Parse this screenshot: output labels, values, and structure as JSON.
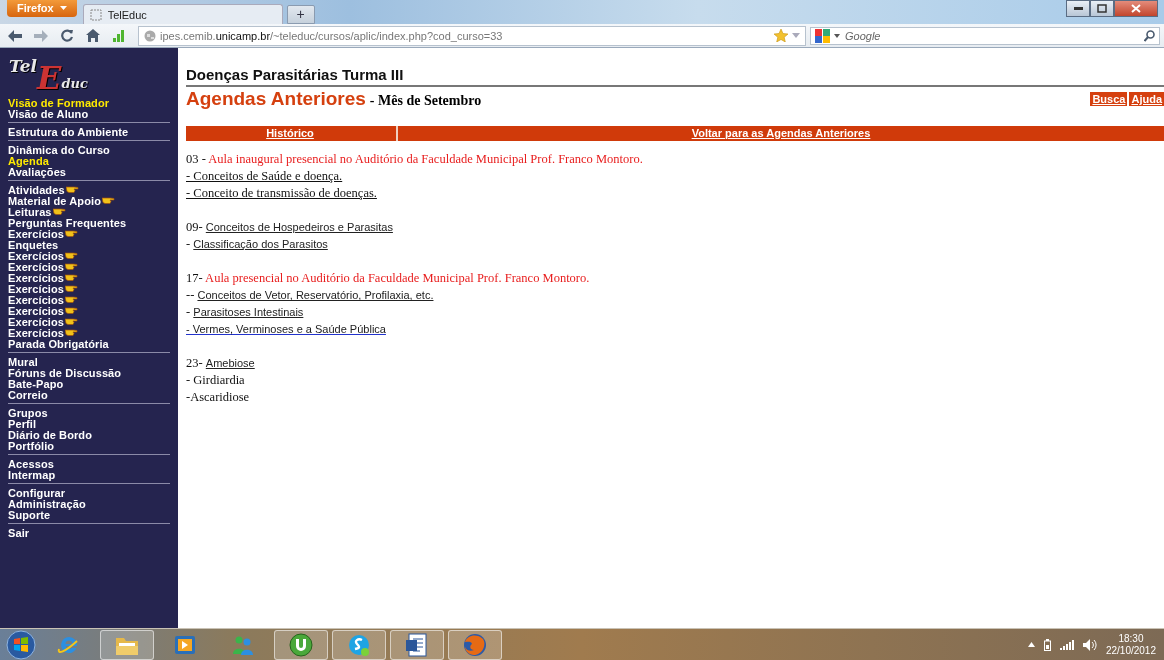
{
  "browser": {
    "menu_button": "Firefox",
    "tabs": [
      {
        "title": "TelEduc",
        "selected": true
      }
    ],
    "new_tab_button": "+",
    "url": "ipes.cemib.**unicamp.br**/~teleduc/cursos/aplic/index.php?cod_curso=33",
    "search_placeholder": "Google"
  },
  "sidebar": {
    "logo": [
      "Tel",
      "E",
      "duc"
    ],
    "groups": [
      {
        "items": [
          {
            "label": "Visão de Formador",
            "selected": true,
            "new": false
          },
          {
            "label": "Visão de Aluno",
            "selected": false,
            "new": false
          }
        ]
      },
      {
        "items": [
          {
            "label": "Estrutura do Ambiente",
            "selected": false,
            "new": false
          }
        ]
      },
      {
        "items": [
          {
            "label": "Dinâmica do Curso",
            "selected": false,
            "new": false
          },
          {
            "label": "Agenda",
            "selected": true,
            "new": false
          },
          {
            "label": "Avaliações",
            "selected": false,
            "new": false
          }
        ]
      },
      {
        "items": [
          {
            "label": "Atividades",
            "selected": false,
            "new": true
          },
          {
            "label": "Material de Apoio",
            "selected": false,
            "new": true
          },
          {
            "label": "Leituras",
            "selected": false,
            "new": true
          },
          {
            "label": "Perguntas Frequentes",
            "selected": false,
            "new": false
          },
          {
            "label": "Exercícios",
            "selected": false,
            "new": true
          },
          {
            "label": "Enquetes",
            "selected": false,
            "new": false
          },
          {
            "label": "Exercícios",
            "selected": false,
            "new": true
          },
          {
            "label": "Exercícios",
            "selected": false,
            "new": true
          },
          {
            "label": "Exercícios",
            "selected": false,
            "new": true
          },
          {
            "label": "Exercícios",
            "selected": false,
            "new": true
          },
          {
            "label": "Exercícios",
            "selected": false,
            "new": true
          },
          {
            "label": "Exercícios",
            "selected": false,
            "new": true
          },
          {
            "label": "Exercícios",
            "selected": false,
            "new": true
          },
          {
            "label": "Exercícios",
            "selected": false,
            "new": true
          },
          {
            "label": "Parada Obrigatória",
            "selected": false,
            "new": false
          }
        ]
      },
      {
        "items": [
          {
            "label": "Mural",
            "selected": false,
            "new": false
          },
          {
            "label": "Fóruns de Discussão",
            "selected": false,
            "new": false
          },
          {
            "label": "Bate-Papo",
            "selected": false,
            "new": false
          },
          {
            "label": "Correio",
            "selected": false,
            "new": false
          }
        ]
      },
      {
        "items": [
          {
            "label": "Grupos",
            "selected": false,
            "new": false
          },
          {
            "label": "Perfil",
            "selected": false,
            "new": false
          },
          {
            "label": "Diário de Bordo",
            "selected": false,
            "new": false
          },
          {
            "label": "Portfólio",
            "selected": false,
            "new": false
          }
        ]
      },
      {
        "items": [
          {
            "label": "Acessos",
            "selected": false,
            "new": false
          },
          {
            "label": "Intermap",
            "selected": false,
            "new": false
          }
        ]
      },
      {
        "items": [
          {
            "label": "Configurar",
            "selected": false,
            "new": false
          },
          {
            "label": "Administração",
            "selected": false,
            "new": false
          },
          {
            "label": "Suporte",
            "selected": false,
            "new": false
          }
        ]
      },
      {
        "items": [
          {
            "label": "Sair",
            "selected": false,
            "new": false
          }
        ]
      }
    ]
  },
  "main": {
    "course_title": "Doenças Parasitárias Turma III",
    "heading": "Agendas Anteriores",
    "subtitle": "- Mês de Setembro",
    "buttons": [
      "Busca",
      "Ajuda"
    ],
    "action_bar": [
      "Histórico",
      "Voltar para as Agendas Anteriores"
    ],
    "agenda": [
      {
        "lines": [
          {
            "segments": [
              {
                "text": "03 - ",
                "kind": "plain"
              },
              {
                "text": "Aula inaugural presencial no Auditório da Faculdade Municipal Prof. Franco Montoro.",
                "kind": "highlight"
              }
            ]
          },
          {
            "segments": [
              {
                "text": "- Conceitos de Saúde e doença.",
                "kind": "doc-link"
              }
            ]
          },
          {
            "segments": [
              {
                "text": "- Conceito de transmissão de doenças.",
                "kind": "doc-link"
              }
            ]
          }
        ]
      },
      {
        "lines": [
          {
            "segments": [
              {
                "text": "09- ",
                "kind": "plain"
              },
              {
                "text": "Conceitos de Hospedeiros e Parasitas",
                "kind": "link"
              }
            ]
          },
          {
            "segments": [
              {
                "text": "- ",
                "kind": "plain"
              },
              {
                "text": "Classificação dos Parasitos",
                "kind": "link"
              }
            ]
          }
        ]
      },
      {
        "lines": [
          {
            "segments": [
              {
                "text": "17- ",
                "kind": "plain"
              },
              {
                "text": "Aula presencial no Auditório da Faculdade Municipal Prof. Franco Montoro.",
                "kind": "highlight"
              }
            ]
          },
          {
            "segments": [
              {
                "text": "-- ",
                "kind": "plain"
              },
              {
                "text": "Conceitos de Vetor, Reservatório, Profilaxia, etc.",
                "kind": "link"
              }
            ]
          },
          {
            "segments": [
              {
                "text": "- ",
                "kind": "plain"
              },
              {
                "text": "Parasitoses Intestinais",
                "kind": "link"
              }
            ]
          },
          {
            "segments": [
              {
                "text": "- Vermes, Verminoses e a Saúde Pública",
                "kind": "visited-link"
              }
            ]
          }
        ]
      },
      {
        "lines": [
          {
            "segments": [
              {
                "text": "23- ",
                "kind": "plain"
              },
              {
                "text": "Amebiose",
                "kind": "link"
              }
            ]
          },
          {
            "segments": [
              {
                "text": "- Girdiardia",
                "kind": "plain"
              }
            ]
          },
          {
            "segments": [
              {
                "text": "-Ascaridiose",
                "kind": "plain"
              }
            ]
          }
        ]
      }
    ]
  },
  "taskbar": {
    "apps": [
      {
        "kind": "browser",
        "running": false
      },
      {
        "kind": "folder",
        "running": true
      },
      {
        "kind": "media",
        "running": false
      },
      {
        "kind": "people",
        "running": false
      },
      {
        "kind": "torrent",
        "running": true
      },
      {
        "kind": "chat",
        "running": true
      },
      {
        "kind": "document",
        "running": true
      },
      {
        "kind": "firefox",
        "running": true
      }
    ],
    "clock_time": "18:30",
    "clock_date": "22/10/2012"
  }
}
